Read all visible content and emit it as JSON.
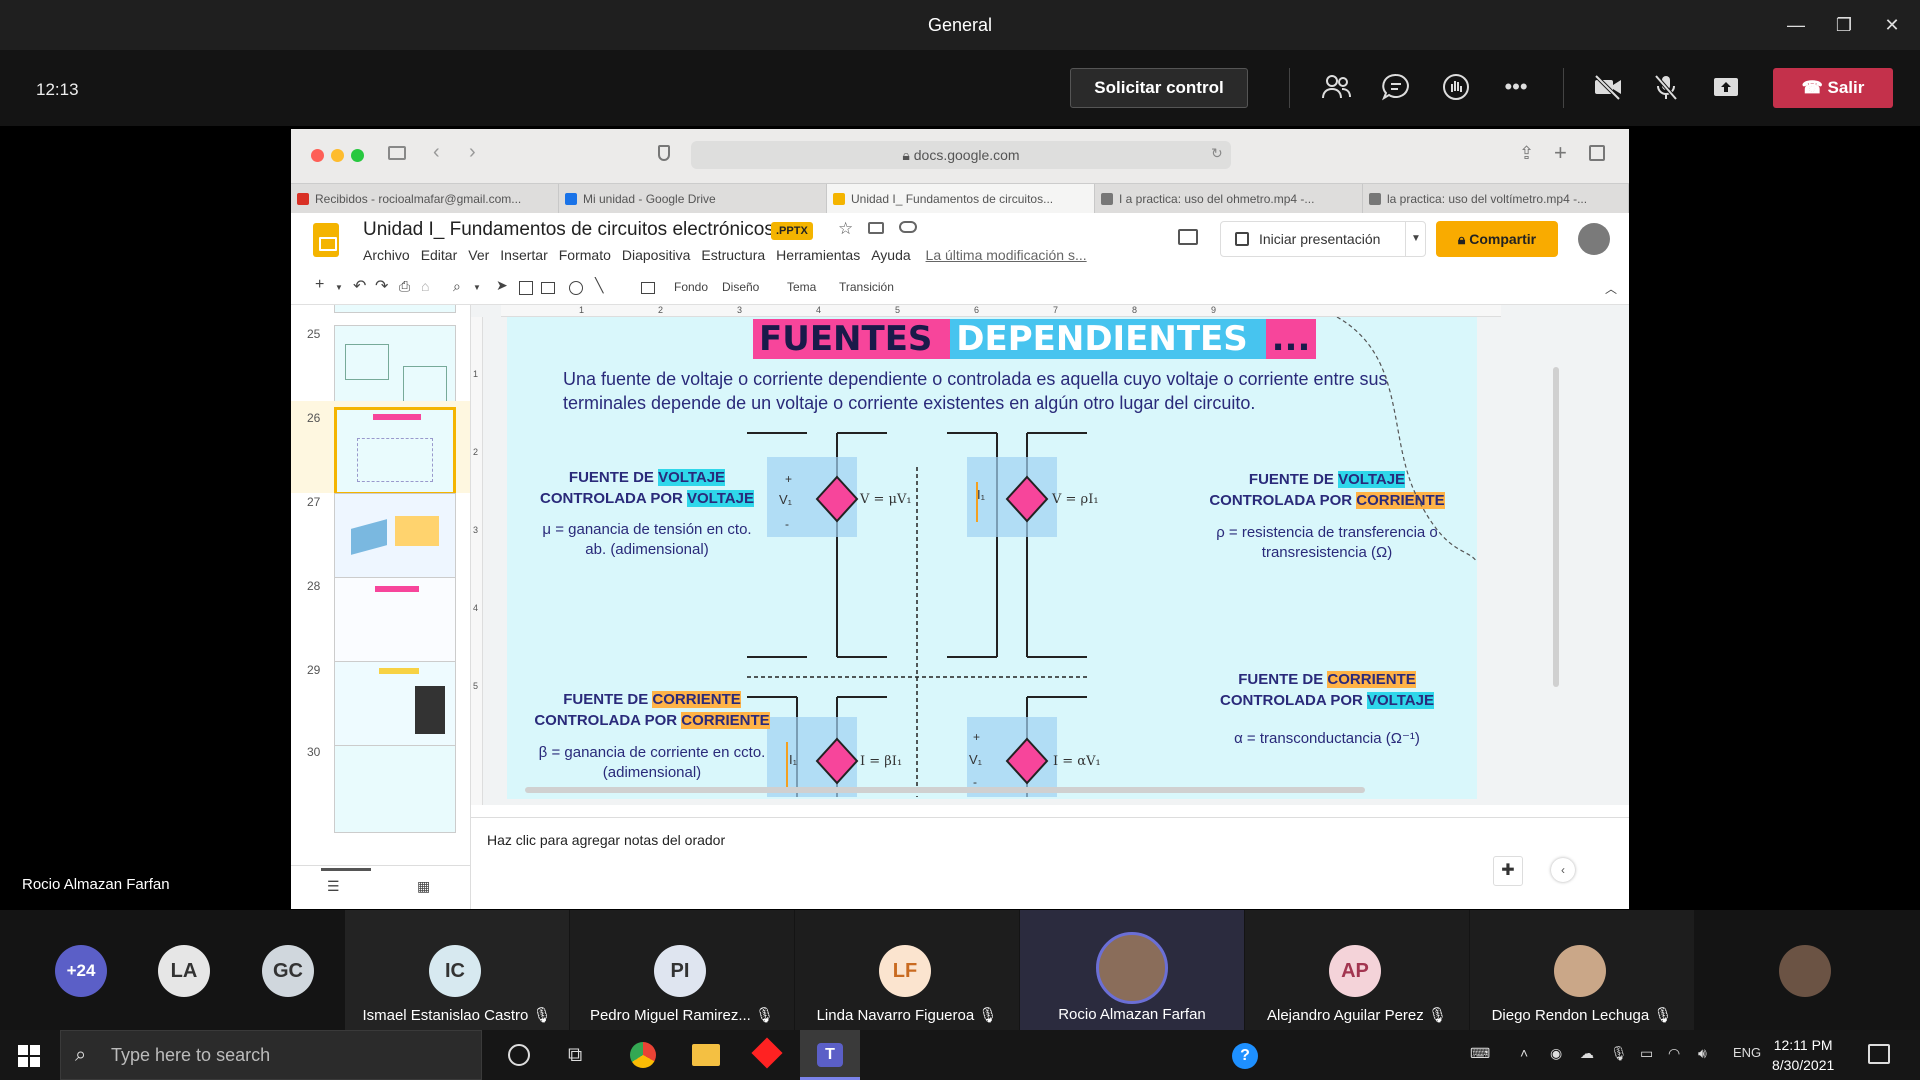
{
  "window": {
    "title": "General",
    "clock": "12:13"
  },
  "toolbar": {
    "request_control": "Solicitar control",
    "leave": "Salir"
  },
  "presenter": {
    "name": "Rocio Almazan Farfan"
  },
  "browser": {
    "url": "docs.google.com",
    "tabs": [
      {
        "label": "Recibidos - rocioalmafar@gmail.com...",
        "color": "#d93025"
      },
      {
        "label": "Mi unidad - Google Drive",
        "color": "#1a73e8"
      },
      {
        "label": "Unidad I_ Fundamentos de circuitos...",
        "color": "#f4b400"
      },
      {
        "label": "I a practica: uso del ohmetro.mp4 -...",
        "color": "#777777"
      },
      {
        "label": "la practica: uso del voltímetro.mp4 -...",
        "color": "#777777"
      }
    ]
  },
  "doc": {
    "title": "Unidad I_ Fundamentos de circuitos electrónicos",
    "badge": ".PPTX",
    "menus": [
      "Archivo",
      "Editar",
      "Ver",
      "Insertar",
      "Formato",
      "Diapositiva",
      "Estructura",
      "Herramientas",
      "Ayuda"
    ],
    "last_modified": "La última modificación s...",
    "present": "Iniciar presentación",
    "share": "Compartir"
  },
  "edit_toolbar": {
    "fondo": "Fondo",
    "diseno": "Diseño",
    "tema": "Tema",
    "transicion": "Transición"
  },
  "filmstrip": {
    "numbers": [
      "25",
      "26",
      "27",
      "28",
      "29",
      "30"
    ]
  },
  "ruler": [
    "1",
    "2",
    "3",
    "4",
    "5",
    "6",
    "7",
    "8",
    "9"
  ],
  "vruler": [
    "1",
    "2",
    "3",
    "4",
    "5"
  ],
  "slide": {
    "title_a": "FUENTES ",
    "title_b": "DEPENDIENTES ",
    "title_c": "...",
    "intro": "Una fuente de voltaje o corriente dependiente o controlada es aquella cuyo voltaje o corriente entre sus terminales depende de un voltaje o corriente existentes en algún otro lugar del circuito.",
    "q1": {
      "l1a": "FUENTE DE ",
      "l1b": "VOLTAJE",
      "l2a": "CONTROLADA POR ",
      "l2b": "VOLTAJE",
      "desc": "μ = ganancia de tensión en cto. ab. (adimensional)"
    },
    "q2": {
      "l1a": "FUENTE DE ",
      "l1b": "VOLTAJE",
      "l2a": "CONTROLADA POR ",
      "l2b": "CORRIENTE",
      "desc": "ρ = resistencia de transferencia o transresistencia (Ω)"
    },
    "q3": {
      "l1a": "FUENTE DE ",
      "l1b": "CORRIENTE",
      "l2a": "CONTROLADA POR ",
      "l2b": "CORRIENTE",
      "desc": "β = ganancia de corriente en ccto. (adimensional)"
    },
    "q4": {
      "l1a": "FUENTE DE ",
      "l1b": "CORRIENTE",
      "l2a": "CONTROLADA POR ",
      "l2b": "VOLTAJE",
      "desc": "α = transconductancia (Ω⁻¹)"
    },
    "eq1": "V = μV₁",
    "eq2": "V = ρI₁",
    "eq3": "I = βI₁",
    "eq4": "I = αV₁",
    "v1": "V₁",
    "i1": "I₁"
  },
  "notes": "Haz clic para agregar notas del orador",
  "participants": [
    {
      "initials": "+24",
      "name": "",
      "color": "#5b5fc7"
    },
    {
      "initials": "LA",
      "name": "",
      "color": "#e6e6e6"
    },
    {
      "initials": "GC",
      "name": "",
      "color": "#d0d7dd"
    },
    {
      "initials": "IC",
      "name": "Ismael Estanislao Castro",
      "color": "#d7e9f0"
    },
    {
      "initials": "PI",
      "name": "Pedro Miguel Ramirez...",
      "color": "#dfe5f0"
    },
    {
      "initials": "LF",
      "name": "Linda Navarro Figueroa",
      "color": "#fbe4cf"
    },
    {
      "initials": "",
      "name": "Rocio Almazan Farfan",
      "color": "#8a6d5a"
    },
    {
      "initials": "AP",
      "name": "Alejandro Aguilar Perez",
      "color": "#f4d3d9"
    },
    {
      "initials": "",
      "name": "Diego Rendon Lechuga",
      "color": "#caa788"
    },
    {
      "initials": "",
      "name": "",
      "color": "#6b5344"
    }
  ],
  "taskbar": {
    "search_placeholder": "Type here to search",
    "time": "12:11 PM",
    "date": "8/30/2021",
    "lang": "ENG"
  }
}
